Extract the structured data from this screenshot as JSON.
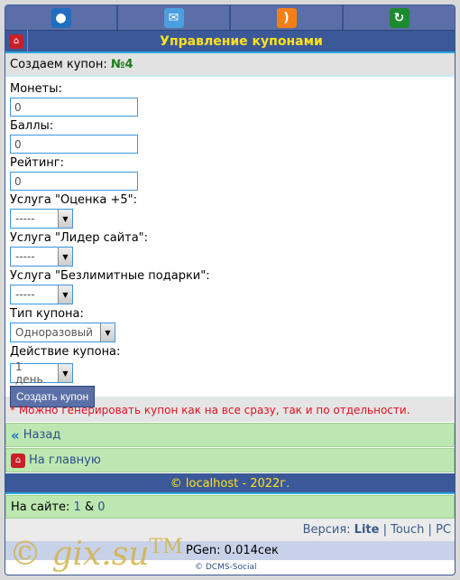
{
  "topnav": [
    {
      "icon": "user-icon",
      "color": "#1f6fc0"
    },
    {
      "icon": "mail-icon",
      "color": "#4a9fe0"
    },
    {
      "icon": "rss-icon",
      "color": "#f57f17"
    },
    {
      "icon": "refresh-icon",
      "color": "#1c8a2e"
    }
  ],
  "header": {
    "title": "Управление купонами"
  },
  "sub": {
    "label": "Создаем купон:",
    "number": "№4"
  },
  "form": {
    "coins_label": "Монеты:",
    "coins_value": "0",
    "points_label": "Баллы:",
    "points_value": "0",
    "rating_label": "Рейтинг:",
    "rating_value": "0",
    "service1_label": "Услуга \"Оценка +5\":",
    "service1_value": "-----",
    "service2_label": "Услуга \"Лидер сайта\":",
    "service2_value": "-----",
    "service3_label": "Услуга \"Безлимитные подарки\":",
    "service3_value": "-----",
    "type_label": "Тип купона:",
    "type_value": "Одноразовый",
    "action_label": "Действие купона:",
    "action_value": "1 день",
    "submit": "Создать купон"
  },
  "note": "* Можно генерировать купон как на все сразу, так и по отдельности.",
  "links": {
    "back": "Назад",
    "home": "На главную"
  },
  "footer": "© localhost - 2022г.",
  "online": {
    "label": "На сайте:",
    "users": "1",
    "sep": "&",
    "guests": "0"
  },
  "version": {
    "label": "Версия:",
    "lite": "Lite",
    "touch": "Touch",
    "pc": "PC"
  },
  "bottom": {
    "watermark": "© gix.su™",
    "pgen": "PGen: 0.014сек",
    "dcms": "© DCMS-Social"
  }
}
